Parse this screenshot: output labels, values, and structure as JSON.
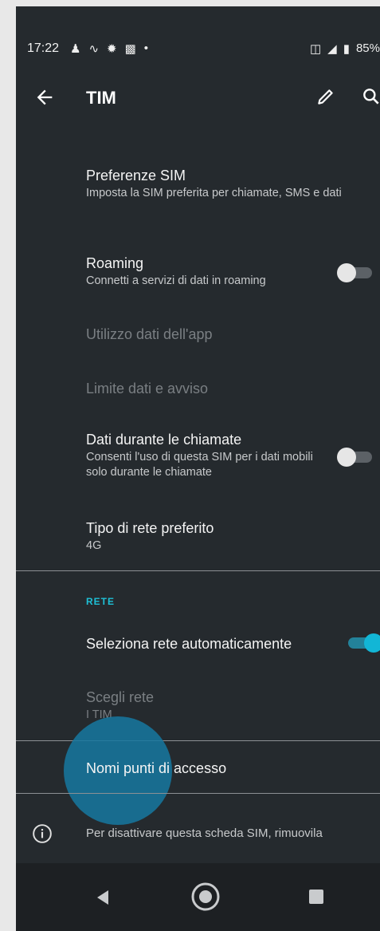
{
  "status_bar": {
    "time": "17:22",
    "left_icons": [
      "account-icon",
      "gesture-icon",
      "bug-icon",
      "qr-icon",
      "dot-icon"
    ],
    "battery_text": "85%"
  },
  "app_bar": {
    "title": "TIM"
  },
  "items": {
    "sim_prefs": {
      "title": "Preferenze SIM",
      "subtitle": "Imposta la SIM preferita per chiamate, SMS e dati"
    },
    "roaming": {
      "title": "Roaming",
      "subtitle": "Connetti a servizi di dati in roaming",
      "toggle": "off"
    },
    "app_data": {
      "title": "Utilizzo dati dell'app"
    },
    "data_limit": {
      "title": "Limite dati e avviso"
    },
    "data_during_calls": {
      "title": "Dati durante le chiamate",
      "subtitle": "Consenti l'uso di questa SIM per i dati mobili solo durante le chiamate",
      "toggle": "off"
    },
    "network_type": {
      "title": "Tipo di rete preferito",
      "subtitle": "4G"
    }
  },
  "network_section": {
    "header": "RETE",
    "auto_select": {
      "title": "Seleziona rete automaticamente",
      "toggle": "on"
    },
    "choose_network": {
      "title": "Scegli rete",
      "subtitle": "I TIM"
    },
    "apn": {
      "title": "Nomi punti di accesso"
    }
  },
  "footer": {
    "info": "Per disattivare questa scheda SIM, rimuovila"
  },
  "colors": {
    "background": "#252a2e",
    "accent": "#1ec0d6",
    "toggle_on": "#12b6d6",
    "touch_highlight": "#1678a0"
  }
}
